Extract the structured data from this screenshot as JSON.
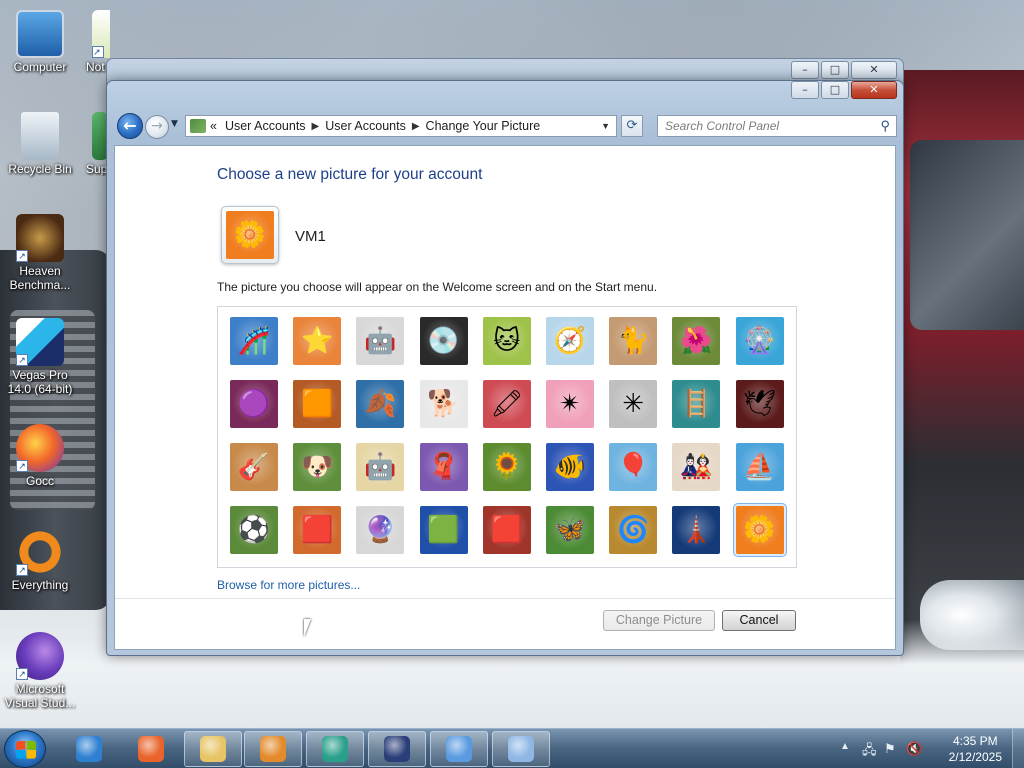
{
  "desktop": {
    "icons": [
      {
        "label": "Computer",
        "icon": "computer-icon"
      },
      {
        "label": "Not",
        "icon": "notepad-icon"
      },
      {
        "label": "Recycle Bin",
        "icon": "recycle-bin-icon"
      },
      {
        "label": "Sup",
        "icon": "support-icon"
      },
      {
        "label": "Heaven Benchma...",
        "icon": "heaven-benchmark-icon"
      },
      {
        "label": "Vegas Pro 14.0 (64-bit)",
        "icon": "vegas-pro-icon"
      },
      {
        "label": "Gocc",
        "icon": "firefox-icon"
      },
      {
        "label": "Everything",
        "icon": "everything-icon"
      },
      {
        "label": "Microsoft Visual Stud...",
        "icon": "visual-studio-icon"
      }
    ]
  },
  "window": {
    "breadcrumb_prefix": "«",
    "breadcrumbs": [
      "User Accounts",
      "User Accounts",
      "Change Your Picture"
    ],
    "search_placeholder": "Search Control Panel",
    "caption": {
      "minimize": "–",
      "maximize": "□",
      "close": "✕"
    },
    "page_title": "Choose a new picture for your account",
    "user_name": "VM1",
    "description": "The picture you choose will appear on the Welcome screen and on the Start menu.",
    "browse_link": "Browse for more pictures...",
    "buttons": {
      "change_picture": "Change Picture",
      "cancel": "Cancel"
    },
    "change_picture_enabled": false
  },
  "pictures": [
    {
      "name": "roller-coaster",
      "glyph": "🎢",
      "bg": "#3d7fc9"
    },
    {
      "name": "starfish",
      "glyph": "⭐",
      "bg": "#e9843a"
    },
    {
      "name": "robot-toy",
      "glyph": "🤖",
      "bg": "#d8d8d8"
    },
    {
      "name": "record-player",
      "glyph": "💿",
      "bg": "#2a2a2a"
    },
    {
      "name": "lucky-cat",
      "glyph": "🐱",
      "bg": "#9fc24a"
    },
    {
      "name": "gyroscope",
      "glyph": "🧭",
      "bg": "#b8d6ea"
    },
    {
      "name": "kitten",
      "glyph": "🐈",
      "bg": "#c49a72"
    },
    {
      "name": "red-flower",
      "glyph": "🌺",
      "bg": "#6d8a39"
    },
    {
      "name": "pinwheel",
      "glyph": "🎡",
      "bg": "#3aa6d8"
    },
    {
      "name": "ball",
      "glyph": "🟣",
      "bg": "#7a2a5a"
    },
    {
      "name": "fabric",
      "glyph": "🟧",
      "bg": "#b45a25"
    },
    {
      "name": "leaf",
      "glyph": "🍂",
      "bg": "#3070a8"
    },
    {
      "name": "dog",
      "glyph": "🐕",
      "bg": "#e8e8e8"
    },
    {
      "name": "crayons",
      "glyph": "🖍",
      "bg": "#cf4b53"
    },
    {
      "name": "red-star",
      "glyph": "✴",
      "bg": "#f0a0b8"
    },
    {
      "name": "jacks",
      "glyph": "✳",
      "bg": "#bfbfbf"
    },
    {
      "name": "stairs",
      "glyph": "🪜",
      "bg": "#2e8c8f"
    },
    {
      "name": "origami-crane",
      "glyph": "🕊",
      "bg": "#5c1b1b"
    },
    {
      "name": "guitar",
      "glyph": "🎸",
      "bg": "#c78a4a"
    },
    {
      "name": "pomeranian",
      "glyph": "🐶",
      "bg": "#5f8f3b"
    },
    {
      "name": "tin-robot",
      "glyph": "🤖",
      "bg": "#e6d6a5"
    },
    {
      "name": "scarves",
      "glyph": "🧣",
      "bg": "#7d58b0"
    },
    {
      "name": "sunflower",
      "glyph": "🌻",
      "bg": "#5c8c2e"
    },
    {
      "name": "fish",
      "glyph": "🐠",
      "bg": "#2d55b5"
    },
    {
      "name": "hot-air-balloon",
      "glyph": "🎈",
      "bg": "#6fb3e0"
    },
    {
      "name": "doll",
      "glyph": "🎎",
      "bg": "#e6d8c8"
    },
    {
      "name": "sailboat",
      "glyph": "⛵",
      "bg": "#4ba3db"
    },
    {
      "name": "soccer-ball",
      "glyph": "⚽",
      "bg": "#5b8a3a"
    },
    {
      "name": "textile",
      "glyph": "🟥",
      "bg": "#d26a2e"
    },
    {
      "name": "marbles",
      "glyph": "🔮",
      "bg": "#d7d7d7"
    },
    {
      "name": "window-frame",
      "glyph": "🟩",
      "bg": "#1f4fa8"
    },
    {
      "name": "red-pattern",
      "glyph": "🟥",
      "bg": "#a0352a"
    },
    {
      "name": "butterfly",
      "glyph": "🦋",
      "bg": "#4c8b35"
    },
    {
      "name": "shell-spiral",
      "glyph": "🌀",
      "bg": "#b8892e"
    },
    {
      "name": "lighthouse",
      "glyph": "🗼",
      "bg": "#143a78"
    },
    {
      "name": "orange-daisy",
      "glyph": "🌼",
      "bg": "#f07d1e"
    }
  ],
  "selected_index": 35,
  "taskbar": {
    "apps": [
      {
        "name": "internet-explorer-icon",
        "color": "#2f80d0"
      },
      {
        "name": "firefox-icon",
        "color": "#e8642a"
      },
      {
        "name": "file-explorer-icon",
        "color": "#e7c465"
      },
      {
        "name": "media-player-icon",
        "color": "#e38a2a"
      },
      {
        "name": "chat-app-icon",
        "color": "#2aa08a"
      },
      {
        "name": "vegas-pro-icon",
        "color": "#2a3f7a"
      },
      {
        "name": "control-panel-icon",
        "color": "#5a9be0"
      },
      {
        "name": "magnifier-icon",
        "color": "#8fb7e6"
      }
    ],
    "time": "4:35 PM",
    "date": "2/12/2025"
  }
}
